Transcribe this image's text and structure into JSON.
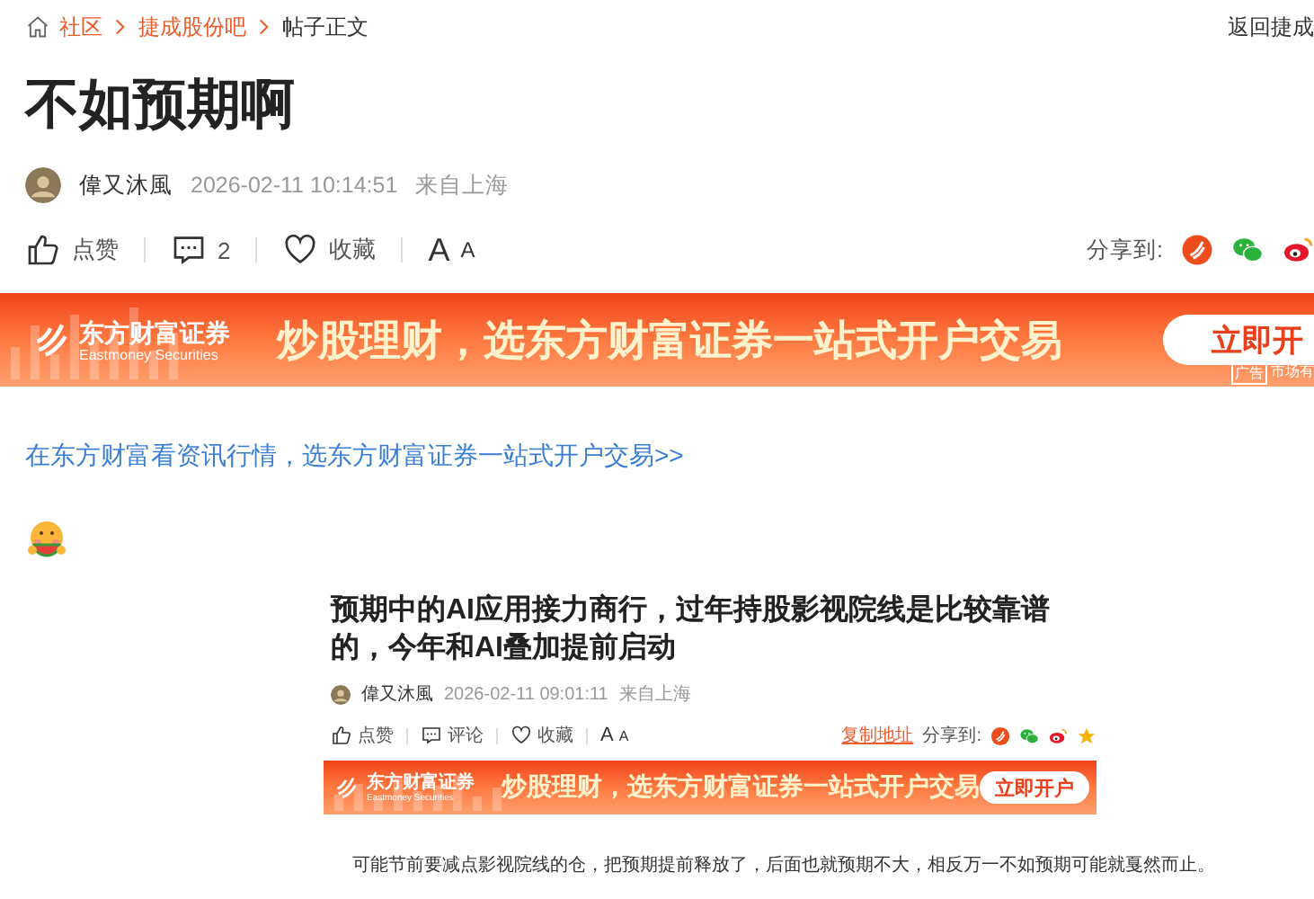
{
  "breadcrumb": [
    {
      "label": "社区",
      "kind": "link"
    },
    {
      "label": "捷成股份吧",
      "kind": "link"
    },
    {
      "label": "帖子正文",
      "kind": "current"
    }
  ],
  "back_link": "返回捷成",
  "post": {
    "title": "不如预期啊",
    "author": "偉又沐風",
    "time": "2026-02-11 10:14:51",
    "location": "来自上海"
  },
  "actions": [
    {
      "kind": "like",
      "label": "点赞"
    },
    {
      "kind": "comment",
      "label": "2"
    },
    {
      "kind": "favorite",
      "label": "收藏"
    },
    {
      "kind": "font",
      "label": "A",
      "small": "A"
    }
  ],
  "share": {
    "label": "分享到:",
    "targets": [
      {
        "kind": "eastmoney"
      },
      {
        "kind": "wechat"
      },
      {
        "kind": "weibo"
      }
    ]
  },
  "ad_banner": {
    "brand": "东方财富证券",
    "brand_en": "Eastmoney Securities",
    "slogan": "炒股理财，选东方财富证券一站式开户交易",
    "button": "立即开",
    "tag": "广告",
    "disclaimer": "市场有"
  },
  "promo_link": "在东方财富看资讯行情，选东方财富证券一站式开户交易>>",
  "body": [
    {
      "kind": "emoji"
    },
    {
      "kind": "screenshot",
      "title": "预期中的AI应用接力商行，过年持股影视院线是比较靠谱的，今年和AI叠加提前启动",
      "author": "偉又沐風",
      "time": "2026-02-11 09:01:11",
      "location": "来自上海",
      "actions": [
        {
          "kind": "like",
          "label": "点赞"
        },
        {
          "kind": "comment",
          "label": "评论"
        },
        {
          "kind": "favorite",
          "label": "收藏"
        },
        {
          "kind": "font",
          "label": "A",
          "small": "A"
        }
      ],
      "copy_link": "复制地址",
      "share_label": "分享到:",
      "share_targets": [
        {
          "kind": "eastmoney"
        },
        {
          "kind": "wechat"
        },
        {
          "kind": "weibo"
        },
        {
          "kind": "star"
        }
      ],
      "ad_banner": {
        "brand": "东方财富证券",
        "brand_en": "Eastmoney Securities",
        "slogan": "炒股理财，选东方财富证券一站式开户交易",
        "button": "立即开户"
      },
      "text": "可能节前要减点影视院线的仓，把预期提前释放了，后面也就预期不大，相反万一不如预期可能就戛然而止。"
    }
  ]
}
